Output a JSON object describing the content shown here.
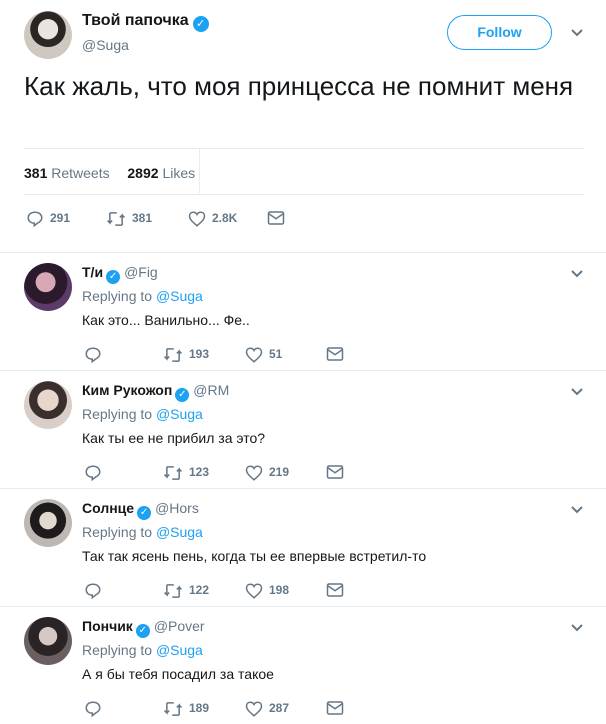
{
  "main": {
    "name": "Твой папочка",
    "handle": "@Suga",
    "follow_label": "Follow",
    "text": "Как жаль, что моя принцесса не помнит меня",
    "retweets_count": "381",
    "retweets_label": "Retweets",
    "likes_count": "2892",
    "likes_label": "Likes",
    "reply_count": "291",
    "retweet_count": "381",
    "like_count": "2.8K"
  },
  "replies": [
    {
      "name": "Т/и",
      "handle": "@Fig",
      "replying_prefix": "Replying to",
      "replying_to": "@Suga",
      "text": "Как это... Ванильно... Фе..",
      "retweets": "193",
      "likes": "51"
    },
    {
      "name": "Ким Рукожоп",
      "handle": "@RM",
      "replying_prefix": "Replying to",
      "replying_to": "@Suga",
      "text": "Как ты ее не прибил за это?",
      "retweets": "123",
      "likes": "219"
    },
    {
      "name": "Солнце",
      "handle": "@Hors",
      "replying_prefix": "Replying to",
      "replying_to": "@Suga",
      "text": "Так так ясень пень, когда ты ее впервые встретил-то",
      "retweets": "122",
      "likes": "198"
    },
    {
      "name": "Пончик",
      "handle": "@Pover",
      "replying_prefix": "Replying to",
      "replying_to": "@Suga",
      "text": "А я бы тебя посадил за такое",
      "retweets": "189",
      "likes": "287"
    }
  ],
  "colors": {
    "accent": "#1da1f2",
    "muted": "#657786",
    "text": "#14171a",
    "border": "#e6ecf0"
  },
  "icons": {
    "reply": "reply-icon",
    "retweet": "retweet-icon",
    "like": "heart-icon",
    "dm": "envelope-icon",
    "verified": "verified-badge-icon",
    "more": "chevron-down-icon"
  }
}
